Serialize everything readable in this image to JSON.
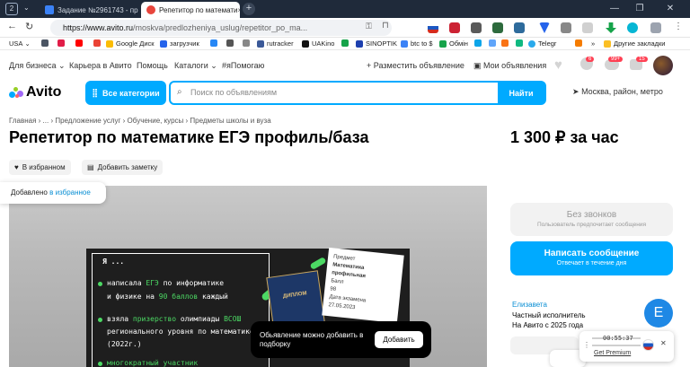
{
  "browser": {
    "tab_counter": "2",
    "tabs": [
      {
        "label": "Задание №2961743 - про",
        "active": false,
        "color": "#e8453c"
      },
      {
        "label": "Репетитор по математи",
        "active": true,
        "color": "#e8453c"
      }
    ],
    "url_domain": "https://www.avito.ru",
    "url_path": "/moskva/predlozheniya_uslug/repetitor_po_ma...",
    "bookmarks": [
      "USA",
      "Google Диск",
      "загрузчик",
      "rutracker",
      "UAKino",
      "SINOPTIK",
      "btc to $",
      "Обмін",
      "Telegr"
    ],
    "other_bookmarks": "Другие закладки"
  },
  "nav": {
    "for_business": "Для бизнеса",
    "career": "Карьера в Авито",
    "help": "Помощь",
    "catalogs": "Каталоги",
    "help_tag": "#яПомогаю",
    "post_ad": "Разместить объявление",
    "my_ads": "Мои объявления",
    "badges": {
      "notifications": "6",
      "messages": "99+",
      "cart": "15"
    }
  },
  "header": {
    "logo": "Avito",
    "all_categories": "Все категории",
    "search_placeholder": "Поиск по объявлениям",
    "search_button": "Найти",
    "location": "Москва, район, метро"
  },
  "breadcrumbs": "Главная › ... › Предложение услуг › Обучение, курсы › Предметы школы и вуза",
  "listing": {
    "title": "Репетитор по математике ЕГЭ профиль/база",
    "price": "1 300 ₽ за час",
    "favorite": "В избранном",
    "add_note": "Добавить заметку",
    "added_toast": "Добавлено",
    "added_toast_link": "в избранное"
  },
  "image": {
    "header": "Я ...",
    "lines": [
      {
        "parts": [
          "написала ",
          "ЕГЭ",
          " по информатике"
        ]
      },
      {
        "parts": [
          "и физике на ",
          "90 баллов",
          " каждый"
        ]
      },
      {
        "parts": [
          "взяла ",
          "призерство",
          " олимпиады ",
          "ВСОШ"
        ]
      },
      {
        "parts": [
          "регионального уровня по математике"
        ]
      },
      {
        "parts": [
          "(2022г.)"
        ]
      },
      {
        "parts": [
          "многократный участник"
        ]
      }
    ],
    "doc_text": [
      "Предмет",
      "Математика профильная",
      "Балл",
      "98",
      "Дата экзамена",
      "27.05.2023"
    ],
    "diploma_label": "ДИПЛОМ"
  },
  "save_toast": {
    "text": "Обьявление можно добавить в подборку",
    "button": "Добавить"
  },
  "contact": {
    "no_calls": "Без звонков",
    "no_calls_sub": "Пользователь предпочитает сообщения",
    "write": "Написать сообщение",
    "write_sub": "Отвечает в течение дня",
    "seller_name": "Елизавета",
    "seller_type": "Частный исполнитель",
    "seller_since": "На Авито с 2025 года",
    "avatar_letter": "E"
  },
  "player": {
    "time": "00:55:37",
    "premium": "Get Premium"
  }
}
